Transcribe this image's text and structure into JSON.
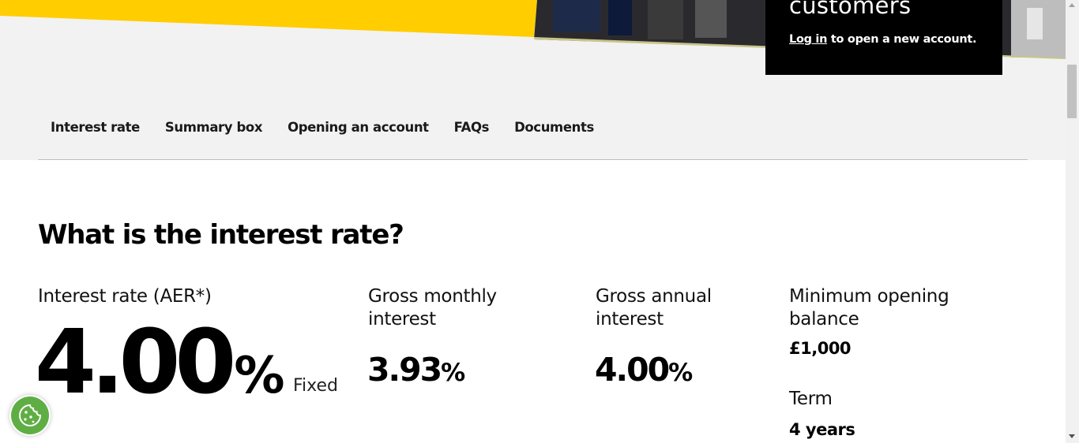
{
  "hero": {
    "promo_heading": "customers",
    "promo_link": "Log in",
    "promo_text": " to open a new account.",
    "yellow_color": "#ffcd00"
  },
  "tabs": [
    {
      "label": "Interest rate"
    },
    {
      "label": "Summary box"
    },
    {
      "label": "Opening an account"
    },
    {
      "label": "FAQs"
    },
    {
      "label": "Documents"
    }
  ],
  "main": {
    "title": "What is the interest rate?",
    "interest_rate": {
      "label": "Interest rate (AER*)",
      "value": "4.00",
      "unit": "%",
      "type": "Fixed"
    },
    "gross_monthly": {
      "label": "Gross monthly interest",
      "value": "3.93",
      "unit": "%"
    },
    "gross_annual": {
      "label": "Gross annual interest",
      "value": "4.00",
      "unit": "%"
    },
    "minimum_opening": {
      "label": "Minimum opening balance",
      "value": "£1,000"
    },
    "term": {
      "label": "Term",
      "value": "4 years"
    }
  },
  "icons": {
    "cookie": "cookie-icon"
  }
}
